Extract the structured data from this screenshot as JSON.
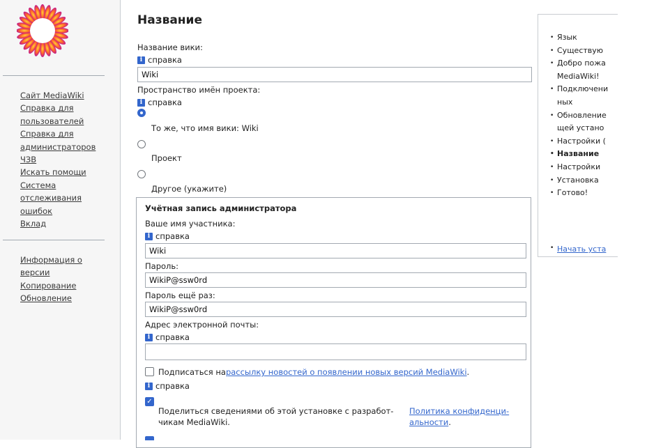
{
  "sidebar": {
    "links1": [
      "Сайт MediaWiki",
      "Справка для",
      "пользователей",
      "Справка для",
      "администраторов",
      "ЧЗВ",
      "Искать помощи",
      "Система",
      "отслеживания",
      "ошибок",
      "Вклад"
    ],
    "links2": [
      "Информация о",
      "версии",
      "Копирование",
      "Обновление"
    ]
  },
  "main": {
    "title": "Название",
    "wiki_name_label": "Название вики:",
    "help": "справка",
    "wiki_name_value": "Wiki",
    "ns_label": "Пространство имён проекта:",
    "ns_options": [
      "То же, что имя вики: Wiki",
      "Проект",
      "Другое (укажите)"
    ],
    "admin": {
      "legend": "Учётная запись администратора",
      "username_label": "Ваше имя участника:",
      "username_value": "Wiki",
      "password_label": "Пароль:",
      "password_value": "WikiP@ssw0rd",
      "password2_label": "Пароль ещё раз:",
      "password2_value": "WikiP@ssw0rd",
      "email_label": "Адрес электронной почты:",
      "email_value": "",
      "subscribe_prefix": "Подписаться на",
      "subscribe_link": "рассылку новостей о появлении новых версий MediaWiki",
      "subscribe_suffix": ".",
      "share_text_1": "Поделиться сведениями об этой установке с разработ-",
      "share_text_2": "чикам MediaWiki.",
      "privacy_link_1": "Политика конфиденци-",
      "privacy_link_2": "альности",
      "privacy_suffix": "."
    }
  },
  "toc": {
    "items": [
      "Язык",
      "Существую",
      "Добро пожа",
      "MediaWiki!",
      "Подключени",
      "ных",
      "Обновление",
      "щей устано",
      "Настройки (",
      "Название",
      "Настройки",
      "Установка",
      "Готово!"
    ],
    "start": "Начать уста"
  },
  "colors": {
    "link": "#3366cc",
    "accent": "#3366cc"
  }
}
